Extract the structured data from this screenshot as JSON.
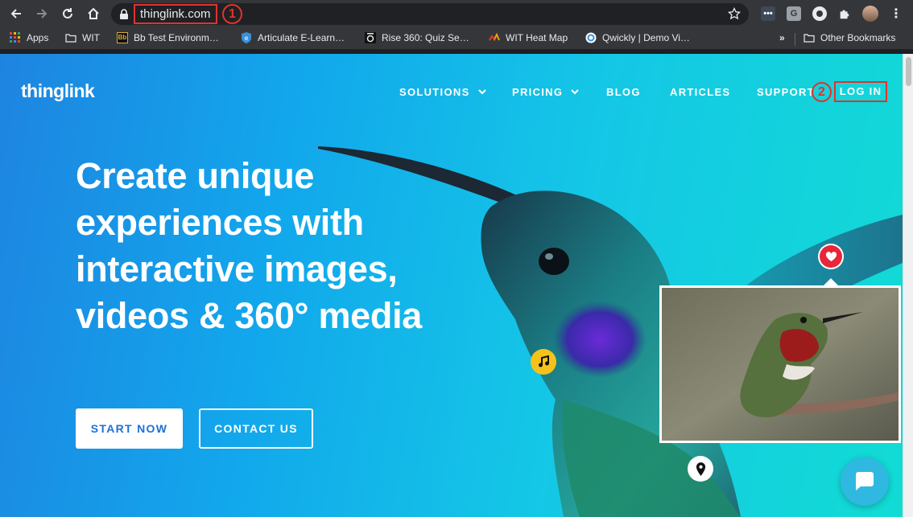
{
  "browser": {
    "url": "thinglink.com",
    "markers": [
      "1",
      "2"
    ],
    "bookmarks": [
      {
        "label": "Apps",
        "icon": "apps-grid-icon"
      },
      {
        "label": "WIT",
        "icon": "folder-icon"
      },
      {
        "label": "Bb Test Environm…",
        "icon": "blackboard-icon"
      },
      {
        "label": "Articulate E-Learn…",
        "icon": "articulate-icon"
      },
      {
        "label": "Rise 360: Quiz Se…",
        "icon": "rise-icon"
      },
      {
        "label": "WIT Heat Map",
        "icon": "heatmap-icon"
      },
      {
        "label": "Qwickly | Demo Vi…",
        "icon": "qwickly-icon"
      }
    ],
    "overflow_label": "»",
    "other_bookmarks": "Other Bookmarks",
    "extensions": [
      "dots-extension",
      "G",
      "record-extension",
      "puzzle-icon",
      "profile-avatar"
    ]
  },
  "site": {
    "logo": "thinglink",
    "nav": {
      "solutions": "SOLUTIONS",
      "pricing": "PRICING",
      "blog": "BLOG",
      "articles": "ARTICLES",
      "support": "SUPPORT",
      "login": "LOG IN"
    },
    "headline": "Create unique experiences with interactive images, videos & 360° media",
    "buttons": {
      "start": "START NOW",
      "contact": "CONTACT US"
    }
  },
  "colors": {
    "brand_blue": "#1e6fd9",
    "annotation_red": "#e0332c",
    "heart_red": "#e8263a",
    "music_yellow": "#f5c21b"
  }
}
